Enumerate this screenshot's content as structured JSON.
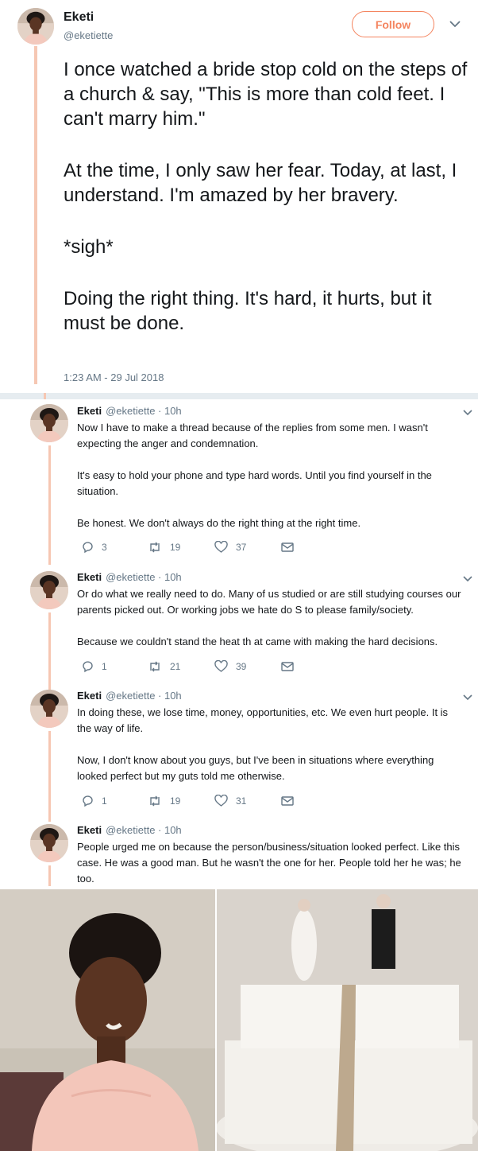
{
  "colors": {
    "accent": "#f4845f",
    "thread_line": "#f6c7b3",
    "muted": "#657786",
    "text": "#14171a"
  },
  "main_tweet": {
    "name": "Eketi",
    "handle": "@eketiette",
    "follow_label": "Follow",
    "paragraphs": [
      "I once watched a bride stop cold on the steps of a church & say, \"This is more than cold feet. I can't marry him.\"",
      "At the time, I only saw her fear. Today, at last, I understand. I'm amazed by her bravery.",
      "*sigh*",
      "Doing the right thing. It's hard, it hurts, but it must be done."
    ],
    "timestamp": "1:23 AM - 29 Jul 2018"
  },
  "replies": [
    {
      "name": "Eketi",
      "meta": "@eketiette · 10h",
      "paragraphs": [
        "Now I have to make a thread because of the replies from some men. I wasn't expecting the anger and condemnation.",
        "It's easy to hold your phone and type hard words. Until you find yourself in the situation.",
        "Be honest. We don't always do the right thing at the right time."
      ],
      "replies_count": "3",
      "retweets_count": "19",
      "likes_count": "37"
    },
    {
      "name": "Eketi",
      "meta": "@eketiette · 10h",
      "paragraphs": [
        "Or do what we really need to do. Many of us studied or are still studying courses our parents picked out. Or working jobs we hate do S to please family/society.",
        "Because we couldn't stand the heat th at came with making the hard decisions."
      ],
      "replies_count": "1",
      "retweets_count": "21",
      "likes_count": "39"
    },
    {
      "name": "Eketi",
      "meta": "@eketiette · 10h",
      "paragraphs": [
        "In doing these, we lose time, money, opportunities, etc. We even hurt people. It is the way of life.",
        "Now, I don't know about you guys, but I've been in situations where everything looked perfect but my guts told me otherwise."
      ],
      "replies_count": "1",
      "retweets_count": "19",
      "likes_count": "31"
    },
    {
      "name": "Eketi",
      "meta": "@eketiette · 10h",
      "paragraphs": [
        "People urged me on because the person/business/situation looked perfect. Like this case. He was a good man. But he wasn't the one for her. People told her he was; he too."
      ]
    }
  ],
  "icons": {
    "reply": "reply-icon",
    "retweet": "retweet-icon",
    "like": "heart-icon",
    "dm": "envelope-icon",
    "chevron": "chevron-down-icon"
  }
}
